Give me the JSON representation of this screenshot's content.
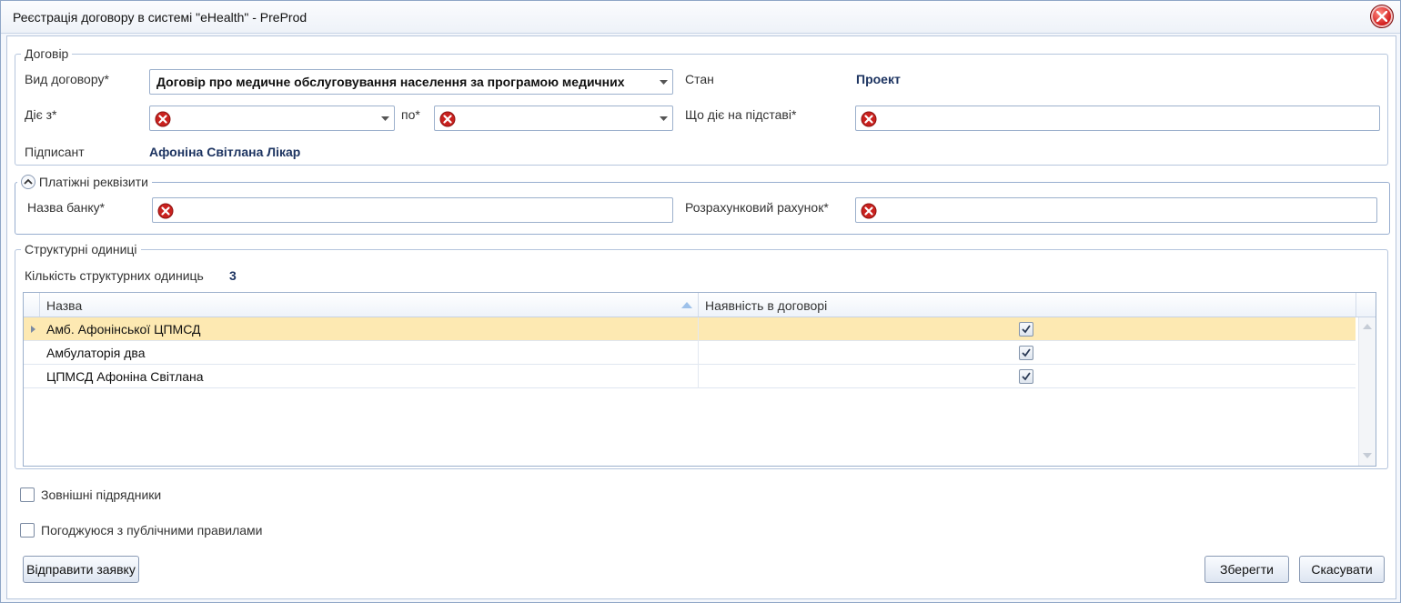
{
  "window": {
    "title": "Реєстрація договору в системі \"eHealth\" - PreProd"
  },
  "contract": {
    "legend": "Договір",
    "type_label": "Вид договору*",
    "type_value": "Договір про медичне обслуговування населення за програмою медичних",
    "status_label": "Стан",
    "status_value": "Проект",
    "from_label": "Діє з*",
    "to_label": "по*",
    "basis_label": "Що діє на підставі*",
    "signer_label": "Підписант",
    "signer_value": "Афоніна Світлана Лікар"
  },
  "payment": {
    "legend": "Платіжні реквізити",
    "bank_label": "Назва банку*",
    "account_label": "Розрахунковий рахунок*"
  },
  "units": {
    "legend": "Структурні одиниці",
    "count_label": "Кількість структурних одиниць",
    "count_value": "3",
    "columns": [
      "Назва",
      "Наявність в договорі"
    ],
    "rows": [
      {
        "name": "Амб. Афонінської ЦПМСД",
        "included": true
      },
      {
        "name": "Амбулаторія два",
        "included": true
      },
      {
        "name": "ЦПМСД Афоніна Світлана",
        "included": true
      }
    ]
  },
  "options": {
    "external_contractors": "Зовнішні підрядники",
    "agree_rules": "Погоджуюся з публічними правилами"
  },
  "buttons": {
    "send": "Відправити заявку",
    "save": "Зберегти",
    "cancel": "Скасувати"
  }
}
